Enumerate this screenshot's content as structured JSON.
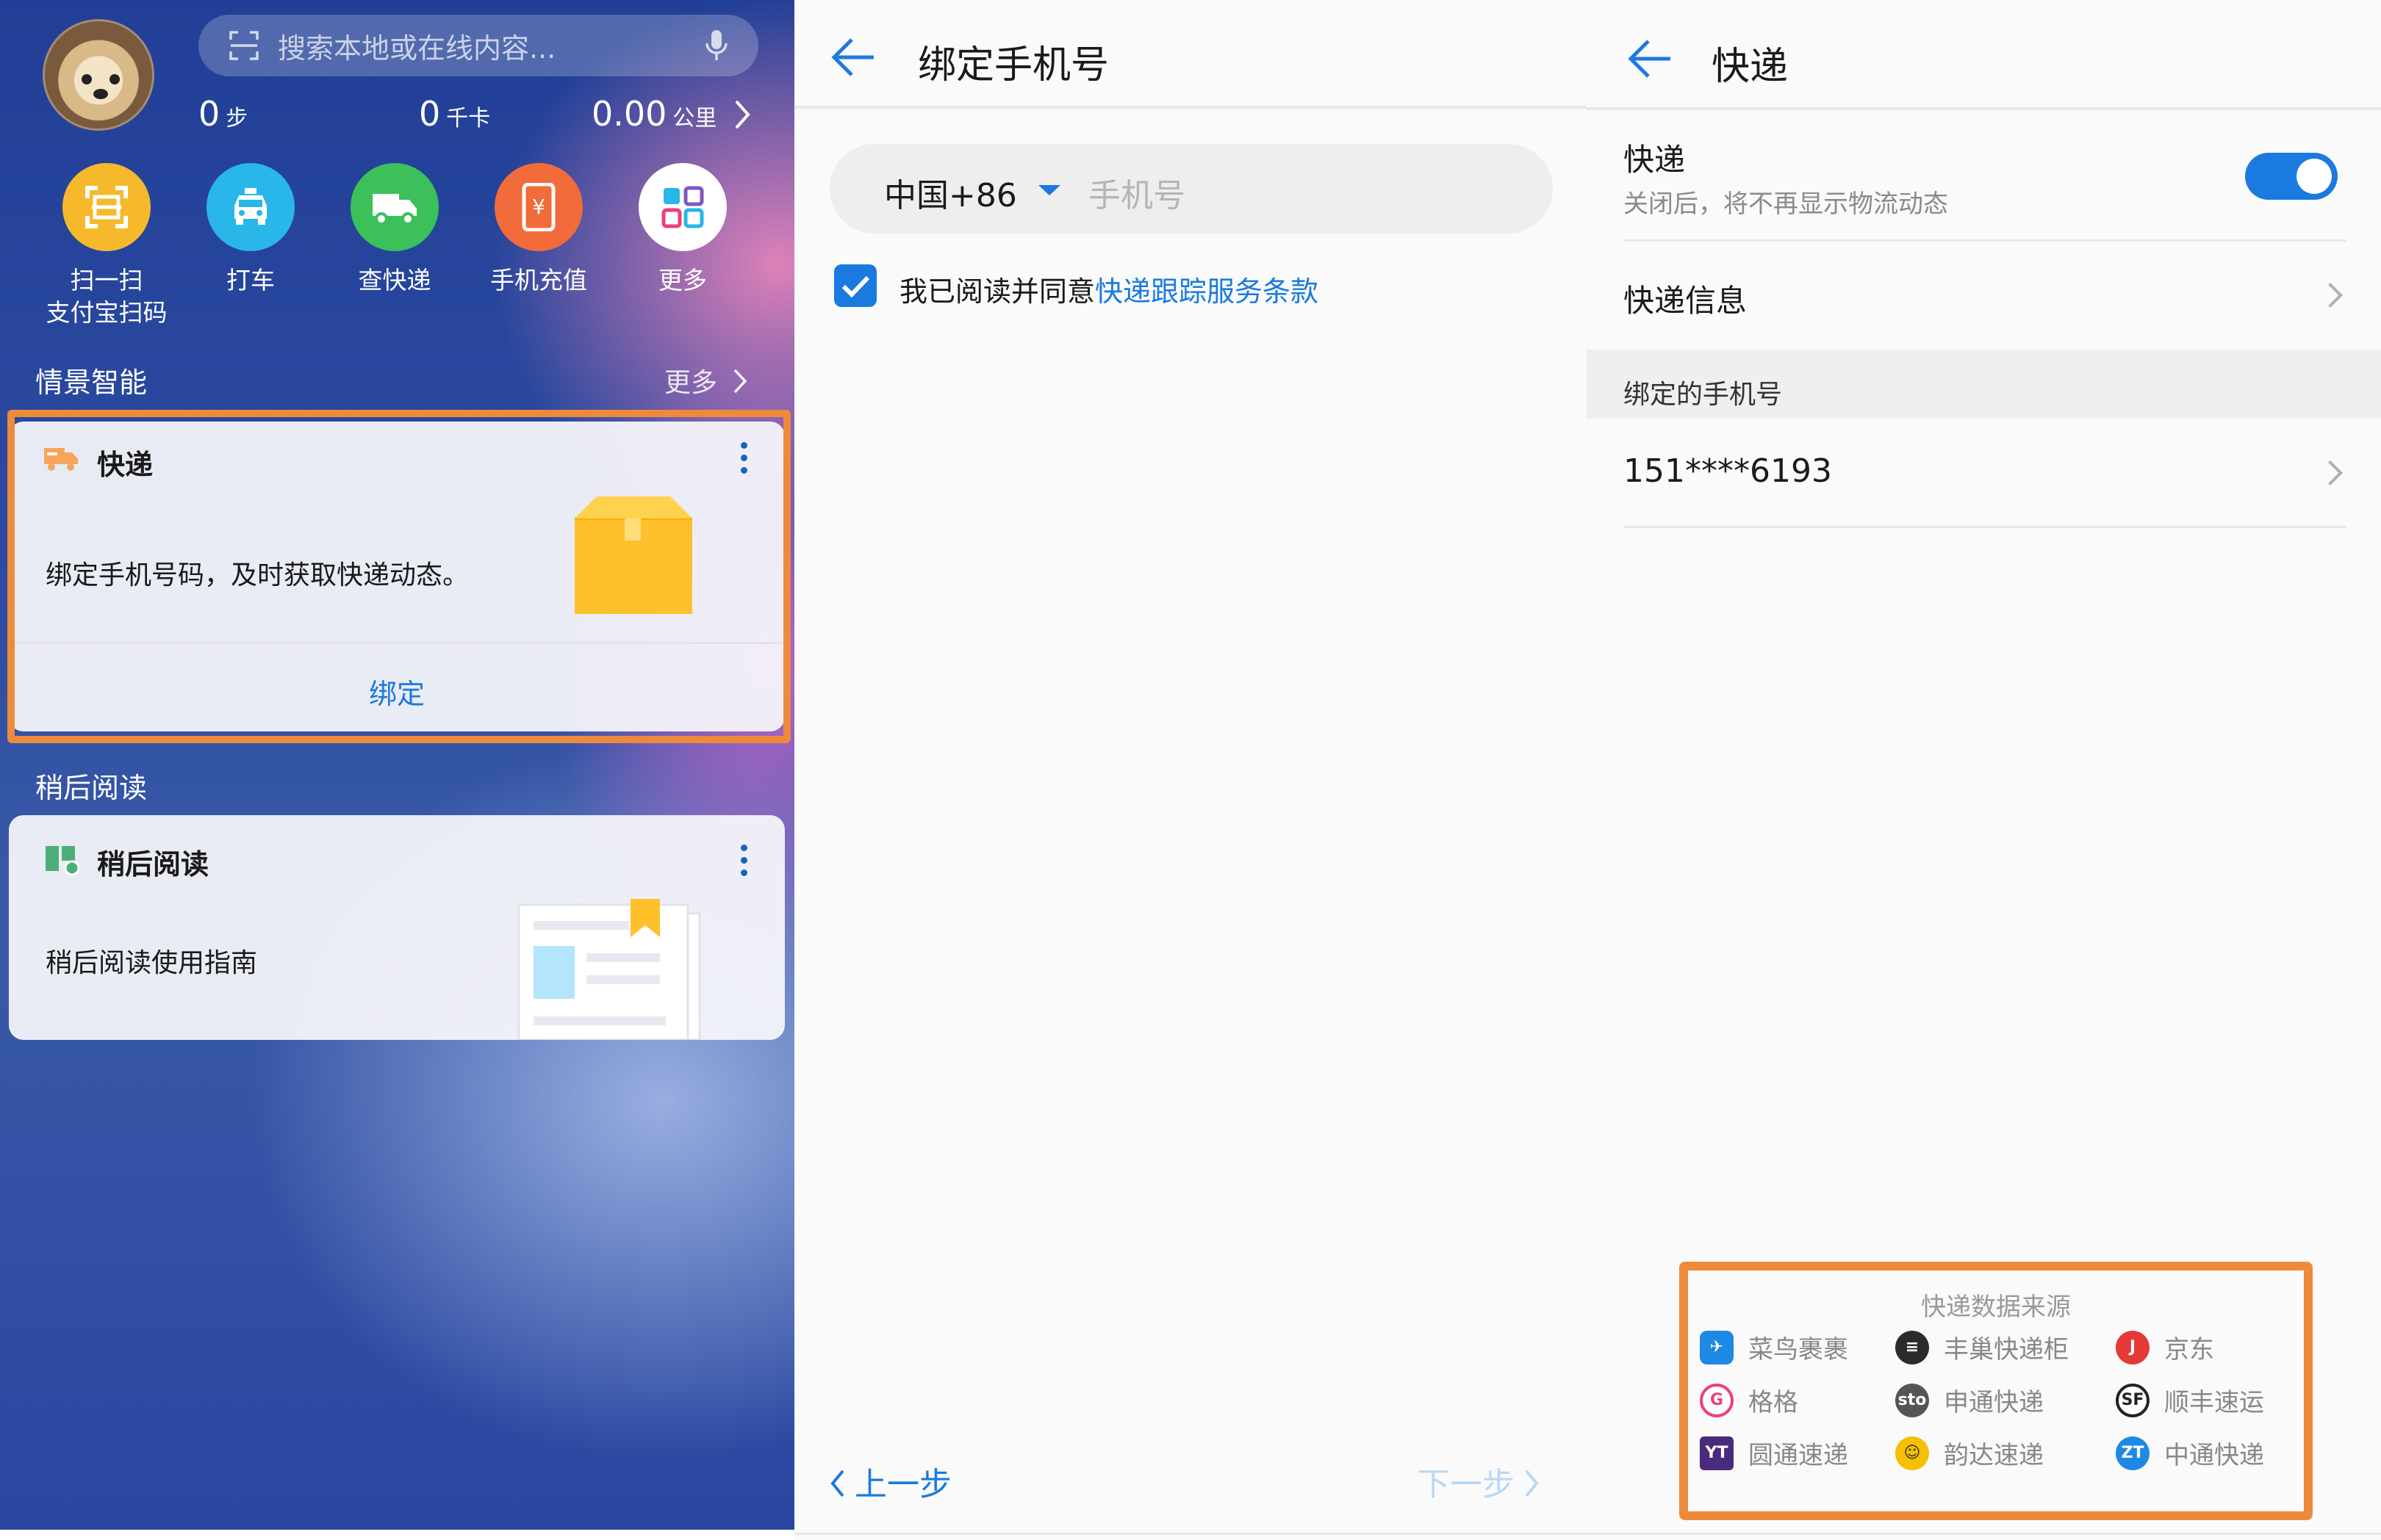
{
  "panel1": {
    "search": {
      "placeholder": "搜索本地或在线内容..."
    },
    "stats": [
      {
        "value": "0",
        "unit": "步"
      },
      {
        "value": "0",
        "unit": "千卡"
      },
      {
        "value": "0.00",
        "unit": "公里"
      }
    ],
    "apps": [
      {
        "label": "扫一扫\n支付宝扫码",
        "line1": "扫一扫",
        "line2": "支付宝扫码",
        "color": "#f6b92b",
        "icon": "scan-icon"
      },
      {
        "label": "打车",
        "line1": "打车",
        "line2": "",
        "color": "#29b6e8",
        "icon": "taxi-icon"
      },
      {
        "label": "查快递",
        "line1": "查快递",
        "line2": "",
        "color": "#3cc05a",
        "icon": "delivery-truck-icon"
      },
      {
        "label": "手机充值",
        "line1": "手机充值",
        "line2": "",
        "color": "#f26b3a",
        "icon": "phone-recharge-icon"
      },
      {
        "label": "更多",
        "line1": "更多",
        "line2": "",
        "color": "#ffffff",
        "icon": "more-apps-icon"
      }
    ],
    "smart_section": {
      "title": "情景智能",
      "more": "更多"
    },
    "express_card": {
      "title": "快递",
      "body": "绑定手机号码，及时获取快递动态。",
      "action": "绑定"
    },
    "read_later_section": {
      "title": "稍后阅读"
    },
    "read_later_card": {
      "title": "稍后阅读",
      "body": "稍后阅读使用指南"
    }
  },
  "panel2": {
    "title": "绑定手机号",
    "country_code": "中国+86",
    "phone_placeholder": "手机号",
    "agree_prefix": "我已阅读并同意",
    "agree_link": "快递跟踪服务条款",
    "prev": "上一步",
    "next": "下一步"
  },
  "panel3": {
    "title": "快递",
    "toggle_title": "快递",
    "toggle_desc": "关闭后，将不再显示物流动态",
    "toggle_on": true,
    "info_label": "快递信息",
    "bound_header": "绑定的手机号",
    "bound_phone": "151****6193",
    "sources_title": "快递数据来源",
    "sources": [
      {
        "name": "菜鸟裹裹",
        "color": "#1e88e5"
      },
      {
        "name": "丰巢快递柜",
        "color": "#2b2b2b"
      },
      {
        "name": "京东",
        "color": "#e53935"
      },
      {
        "name": "格格",
        "color": "#ec407a"
      },
      {
        "name": "申通快递",
        "color": "#555555"
      },
      {
        "name": "顺丰速运",
        "color": "#222222"
      },
      {
        "name": "圆通速递",
        "color": "#4a2a7a"
      },
      {
        "name": "韵达速递",
        "color": "#f6c000"
      },
      {
        "name": "中通快递",
        "color": "#1e88e5"
      }
    ]
  },
  "colors": {
    "accent": "#1a7ae0",
    "highlight": "#ee8a3c"
  }
}
